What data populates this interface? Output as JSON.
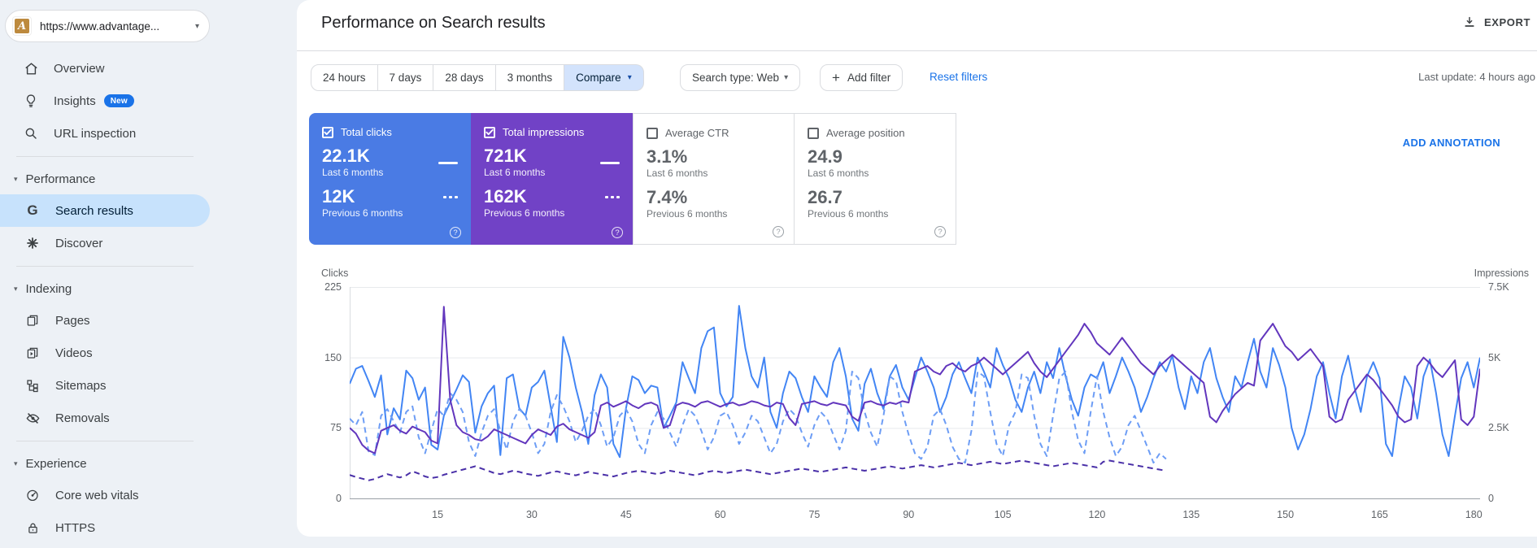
{
  "property": {
    "url": "https://www.advantage...",
    "favicon_letter": "A"
  },
  "sidebar": {
    "top_items": [
      {
        "label": "Overview",
        "icon": "home-icon"
      },
      {
        "label": "Insights",
        "icon": "lightbulb-icon",
        "badge": "New"
      },
      {
        "label": "URL inspection",
        "icon": "search-icon"
      }
    ],
    "sections": [
      {
        "header": "Performance",
        "items": [
          {
            "label": "Search results",
            "icon": "google-g-icon",
            "selected": true
          },
          {
            "label": "Discover",
            "icon": "asterisk-icon"
          }
        ]
      },
      {
        "header": "Indexing",
        "items": [
          {
            "label": "Pages",
            "icon": "pages-icon"
          },
          {
            "label": "Videos",
            "icon": "videos-icon"
          },
          {
            "label": "Sitemaps",
            "icon": "sitemap-icon"
          },
          {
            "label": "Removals",
            "icon": "eye-off-icon"
          }
        ]
      },
      {
        "header": "Experience",
        "items": [
          {
            "label": "Core web vitals",
            "icon": "speedometer-icon"
          },
          {
            "label": "HTTPS",
            "icon": "lock-icon"
          }
        ]
      }
    ]
  },
  "header": {
    "title": "Performance on Search results",
    "export_label": "EXPORT"
  },
  "toolbar": {
    "date_ranges": [
      "24 hours",
      "7 days",
      "28 days",
      "3 months"
    ],
    "compare_label": "Compare",
    "search_type_label": "Search type: Web",
    "add_filter_label": "Add filter",
    "reset_filters_label": "Reset filters",
    "last_update": "Last update: 4 hours ago"
  },
  "cards": [
    {
      "label": "Total clicks",
      "checked": true,
      "bg": "#4a7be4",
      "current": "22.1K",
      "current_period": "Last 6 months",
      "previous": "12K",
      "previous_period": "Previous 6 months"
    },
    {
      "label": "Total impressions",
      "checked": true,
      "bg": "#7142c6",
      "current": "721K",
      "current_period": "Last 6 months",
      "previous": "162K",
      "previous_period": "Previous 6 months"
    },
    {
      "label": "Average CTR",
      "checked": false,
      "bg": "#ffffff",
      "current": "3.1%",
      "current_period": "Last 6 months",
      "previous": "7.4%",
      "previous_period": "Previous 6 months"
    },
    {
      "label": "Average position",
      "checked": false,
      "bg": "#ffffff",
      "current": "24.9",
      "current_period": "Last 6 months",
      "previous": "26.7",
      "previous_period": "Previous 6 months"
    }
  ],
  "annotation_label": "ADD ANNOTATION",
  "chart_data": {
    "type": "line",
    "left_axis": {
      "label": "Clicks",
      "ticks": [
        "225",
        "150",
        "75",
        "0"
      ],
      "max": 225
    },
    "right_axis": {
      "label": "Impressions",
      "ticks": [
        "7.5K",
        "5K",
        "2.5K",
        "0"
      ],
      "max": 7500
    },
    "x_ticks": [
      15,
      30,
      45,
      60,
      75,
      90,
      105,
      120,
      135,
      150,
      165,
      180
    ],
    "x_total_days": 181,
    "grid": true,
    "series": [
      {
        "name": "Clicks - Last 6 months",
        "axis": "left",
        "style": "solid",
        "color": "#4285f4",
        "values": [
          122,
          138,
          141,
          125,
          108,
          131,
          68,
          96,
          84,
          136,
          128,
          105,
          118,
          57,
          52,
          88,
          102,
          116,
          131,
          124,
          70,
          98,
          112,
          120,
          46,
          128,
          132,
          96,
          88,
          118,
          124,
          136,
          98,
          60,
          172,
          150,
          118,
          92,
          58,
          110,
          132,
          118,
          58,
          44,
          96,
          130,
          126,
          112,
          120,
          118,
          75,
          88,
          102,
          145,
          128,
          112,
          160,
          178,
          182,
          112,
          98,
          108,
          205,
          160,
          130,
          118,
          150,
          92,
          75,
          112,
          135,
          128,
          108,
          92,
          130,
          118,
          108,
          145,
          160,
          130,
          85,
          72,
          122,
          138,
          112,
          95,
          130,
          142,
          118,
          105,
          128,
          150,
          135,
          118,
          92,
          108,
          132,
          145,
          128,
          112,
          150,
          135,
          118,
          160,
          142,
          128,
          105,
          92,
          118,
          135,
          112,
          145,
          128,
          160,
          130,
          105,
          88,
          118,
          132,
          128,
          145,
          112,
          130,
          150,
          135,
          118,
          92,
          108,
          128,
          145,
          135,
          152,
          118,
          95,
          130,
          112,
          145,
          160,
          128,
          108,
          92,
          130,
          118,
          145,
          170,
          135,
          118,
          160,
          142,
          118,
          75,
          52,
          68,
          95,
          130,
          145,
          112,
          85,
          130,
          152,
          118,
          92,
          130,
          145,
          128,
          58,
          45,
          95,
          130,
          118,
          85,
          130,
          148,
          112,
          68,
          45,
          88,
          128,
          145,
          118,
          150
        ]
      },
      {
        "name": "Clicks - Previous 6 months",
        "axis": "left",
        "style": "dashed",
        "color": "#6d9df5",
        "values": [
          85,
          78,
          92,
          50,
          46,
          88,
          95,
          82,
          70,
          92,
          98,
          65,
          48,
          72,
          95,
          88,
          112,
          105,
          92,
          60,
          45,
          70,
          88,
          95,
          72,
          52,
          82,
          95,
          88,
          70,
          48,
          58,
          92,
          110,
          98,
          82,
          60,
          72,
          88,
          95,
          78,
          55,
          65,
          88,
          95,
          82,
          58,
          48,
          78,
          92,
          85,
          70,
          55,
          78,
          95,
          88,
          72,
          52,
          65,
          88,
          92,
          78,
          58,
          70,
          88,
          82,
          65,
          48,
          58,
          82,
          95,
          88,
          70,
          55,
          78,
          92,
          85,
          68,
          52,
          72,
          135,
          128,
          92,
          70,
          55,
          88,
          130,
          125,
          92,
          68,
          48,
          42,
          55,
          88,
          95,
          78,
          55,
          42,
          38,
          72,
          135,
          130,
          92,
          58,
          45,
          78,
          92,
          132,
          128,
          88,
          58,
          45,
          88,
          128,
          135,
          92,
          62,
          48,
          92,
          130,
          92,
          65,
          45,
          55,
          78,
          88,
          72,
          55,
          38,
          48,
          42
        ]
      },
      {
        "name": "Impressions - Last 6 months",
        "axis": "right",
        "style": "solid",
        "color": "#6236bd",
        "values": [
          2500,
          2300,
          1900,
          1700,
          1600,
          2400,
          2500,
          2600,
          2400,
          2300,
          2550,
          2450,
          2350,
          2050,
          1950,
          6800,
          3500,
          2600,
          2350,
          2250,
          2100,
          2050,
          2200,
          2450,
          2350,
          2250,
          2150,
          2050,
          1950,
          2250,
          2450,
          2350,
          2250,
          2550,
          2650,
          2450,
          2350,
          2250,
          2150,
          2350,
          3300,
          3400,
          3250,
          3350,
          3450,
          3300,
          3200,
          3350,
          3400,
          3300,
          2500,
          2600,
          3300,
          3400,
          3350,
          3250,
          3400,
          3450,
          3350,
          3250,
          3350,
          3400,
          3300,
          3350,
          3450,
          3400,
          3300,
          3250,
          3400,
          3350,
          2850,
          2600,
          3350,
          3400,
          3450,
          3350,
          3300,
          3400,
          3350,
          3300,
          2900,
          2750,
          3400,
          3450,
          3350,
          3300,
          3400,
          3350,
          3450,
          3400,
          4500,
          4600,
          4700,
          4500,
          4400,
          4700,
          4800,
          4600,
          4500,
          4700,
          4800,
          5000,
          4800,
          4600,
          4400,
          4600,
          4800,
          5000,
          5200,
          4800,
          4500,
          4300,
          4600,
          4900,
          5200,
          5500,
          5800,
          6200,
          5900,
          5500,
          5300,
          5100,
          5400,
          5700,
          5400,
          5100,
          4800,
          4600,
          4400,
          4700,
          4900,
          5100,
          4900,
          4700,
          4500,
          4300,
          4100,
          2900,
          2700,
          3100,
          3400,
          3700,
          3900,
          4100,
          4000,
          5600,
          5900,
          6200,
          5800,
          5400,
          5200,
          4900,
          5100,
          5300,
          5000,
          4700,
          2900,
          2700,
          2800,
          3500,
          3800,
          4100,
          4400,
          4200,
          3900,
          3600,
          3300,
          2900,
          2700,
          2800,
          4700,
          5000,
          4800,
          4500,
          4300,
          4600,
          4900,
          2800,
          2600,
          2900,
          4600
        ]
      },
      {
        "name": "Impressions - Previous 6 months",
        "axis": "right",
        "style": "dashed",
        "color": "#4a30a8",
        "values": [
          830,
          760,
          700,
          640,
          690,
          780,
          860,
          800,
          740,
          820,
          960,
          880,
          780,
          720,
          760,
          840,
          900,
          960,
          1020,
          1080,
          1140,
          1060,
          980,
          900,
          860,
          920,
          980,
          940,
          880,
          840,
          800,
          860,
          920,
          960,
          900,
          860,
          820,
          880,
          940,
          900,
          860,
          820,
          780,
          840,
          900,
          940,
          980,
          940,
          900,
          860,
          920,
          980,
          940,
          900,
          860,
          820,
          880,
          940,
          980,
          940,
          900,
          940,
          980,
          1020,
          980,
          940,
          900,
          860,
          900,
          940,
          980,
          1020,
          1060,
          1020,
          980,
          940,
          980,
          1020,
          1060,
          1100,
          1060,
          1020,
          980,
          1020,
          1060,
          1100,
          1140,
          1100,
          1060,
          1100,
          1140,
          1180,
          1140,
          1100,
          1140,
          1180,
          1220,
          1260,
          1220,
          1180,
          1220,
          1260,
          1300,
          1260,
          1220,
          1260,
          1300,
          1340,
          1300,
          1260,
          1220,
          1180,
          1140,
          1180,
          1220,
          1260,
          1220,
          1180,
          1140,
          1100,
          1300,
          1340,
          1300,
          1260,
          1220,
          1180,
          1140,
          1100,
          1060,
          1020,
          980
        ]
      }
    ]
  }
}
